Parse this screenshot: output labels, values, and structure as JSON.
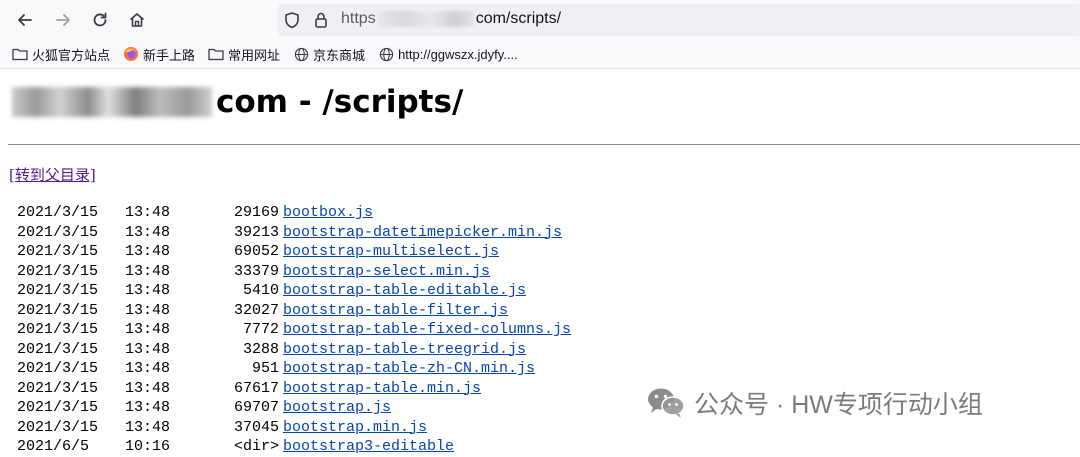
{
  "browser": {
    "url_scheme": "https",
    "url_rest": "com/scripts/",
    "bookmarks": [
      {
        "icon": "folder-icon",
        "label": "火狐官方站点"
      },
      {
        "icon": "firefox-icon",
        "label": "新手上路"
      },
      {
        "icon": "folder-icon",
        "label": "常用网址"
      },
      {
        "icon": "globe-icon",
        "label": "京东商城"
      },
      {
        "icon": "globe-icon",
        "label": "http://ggwszx.jdyfy...."
      }
    ]
  },
  "page": {
    "title_suffix": "com - /scripts/",
    "parent_link": "[转到父目录]",
    "files": [
      {
        "date": "2021/3/15",
        "time": "13:48",
        "size": "29169",
        "name": "bootbox.js"
      },
      {
        "date": "2021/3/15",
        "time": "13:48",
        "size": "39213",
        "name": "bootstrap-datetimepicker.min.js"
      },
      {
        "date": "2021/3/15",
        "time": "13:48",
        "size": "69052",
        "name": "bootstrap-multiselect.js"
      },
      {
        "date": "2021/3/15",
        "time": "13:48",
        "size": "33379",
        "name": "bootstrap-select.min.js"
      },
      {
        "date": "2021/3/15",
        "time": "13:48",
        "size": "5410",
        "name": "bootstrap-table-editable.js"
      },
      {
        "date": "2021/3/15",
        "time": "13:48",
        "size": "32027",
        "name": "bootstrap-table-filter.js"
      },
      {
        "date": "2021/3/15",
        "time": "13:48",
        "size": "7772",
        "name": "bootstrap-table-fixed-columns.js"
      },
      {
        "date": "2021/3/15",
        "time": "13:48",
        "size": "3288",
        "name": "bootstrap-table-treegrid.js"
      },
      {
        "date": "2021/3/15",
        "time": "13:48",
        "size": "951",
        "name": "bootstrap-table-zh-CN.min.js"
      },
      {
        "date": "2021/3/15",
        "time": "13:48",
        "size": "67617",
        "name": "bootstrap-table.min.js"
      },
      {
        "date": "2021/3/15",
        "time": "13:48",
        "size": "69707",
        "name": "bootstrap.js"
      },
      {
        "date": "2021/3/15",
        "time": "13:48",
        "size": "37045",
        "name": "bootstrap.min.js"
      },
      {
        "date": "2021/6/5",
        "time": "10:16",
        "size": "<dir>",
        "name": "bootstrap3-editable"
      }
    ]
  },
  "watermark": {
    "text": "公众号 · HW专项行动小组"
  }
}
